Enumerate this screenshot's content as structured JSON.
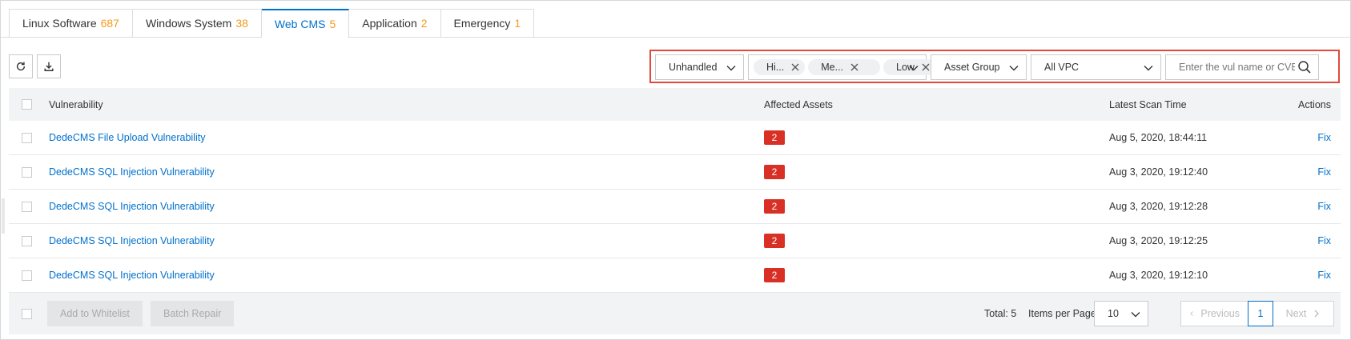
{
  "tabs": [
    {
      "label": "Linux Software",
      "count": "687"
    },
    {
      "label": "Windows System",
      "count": "38"
    },
    {
      "label": "Web CMS",
      "count": "5"
    },
    {
      "label": "Application",
      "count": "2"
    },
    {
      "label": "Emergency",
      "count": "1"
    }
  ],
  "active_tab": "Web CMS",
  "toolbar": {
    "refresh_icon": "refresh-icon",
    "export_icon": "download-icon"
  },
  "filters": {
    "status": "Unhandled",
    "severity_tags": [
      "Hi...",
      "Me...",
      "Low"
    ],
    "asset_group": "Asset Group",
    "vpc": "All VPC",
    "search_placeholder": "Enter the vul name or CVE"
  },
  "table": {
    "columns": {
      "vulnerability": "Vulnerability",
      "affected": "Affected Assets",
      "time": "Latest Scan Time",
      "actions": "Actions"
    },
    "rows": [
      {
        "name": "DedeCMS File Upload Vulnerability",
        "affected": "2",
        "time": "Aug 5, 2020, 18:44:11",
        "action": "Fix"
      },
      {
        "name": "DedeCMS SQL Injection Vulnerability",
        "affected": "2",
        "time": "Aug 3, 2020, 19:12:40",
        "action": "Fix"
      },
      {
        "name": "DedeCMS SQL Injection Vulnerability",
        "affected": "2",
        "time": "Aug 3, 2020, 19:12:28",
        "action": "Fix"
      },
      {
        "name": "DedeCMS SQL Injection Vulnerability",
        "affected": "2",
        "time": "Aug 3, 2020, 19:12:25",
        "action": "Fix"
      },
      {
        "name": "DedeCMS SQL Injection Vulnerability",
        "affected": "2",
        "time": "Aug 3, 2020, 19:12:10",
        "action": "Fix"
      }
    ]
  },
  "footer": {
    "whitelist": "Add to Whitelist",
    "batch_repair": "Batch Repair",
    "total": "Total: 5",
    "items_per_page_label": "Items per Page",
    "items_per_page": "10",
    "previous": "Previous",
    "page": "1",
    "next": "Next"
  },
  "colors": {
    "accent": "#0070cc",
    "count": "#f39b1b",
    "badge": "#d93026",
    "highlight_border": "#e1493a"
  }
}
